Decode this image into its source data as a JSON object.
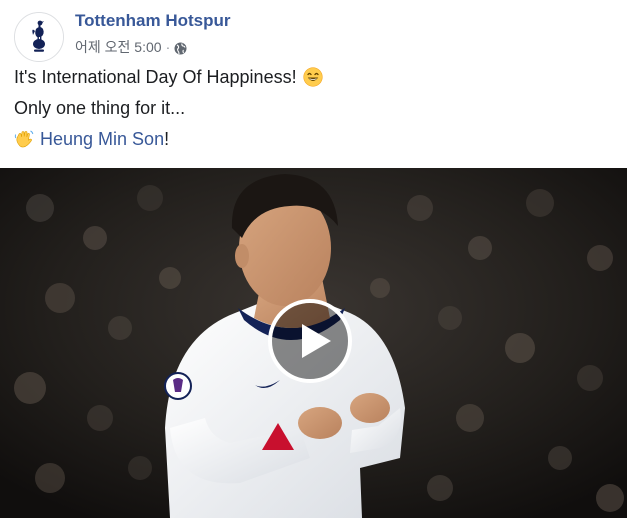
{
  "post": {
    "page_name": "Tottenham Hotspur",
    "time": "어제 오전 5:00",
    "separator": "·",
    "privacy_icon": "globe-icon",
    "lines": [
      "It's International Day Of Happiness!",
      "Only one thing for it...",
      "Heung Min Son!"
    ],
    "mention": "Heung Min Son",
    "mention_suffix": "!",
    "emojis": [
      "grinning-face-emoji",
      "waving-hand-emoji"
    ]
  },
  "media": {
    "type": "video",
    "play_icon": "play-icon"
  },
  "colors": {
    "link": "#385898",
    "text": "#1c1e21",
    "meta": "#616770",
    "spurs_navy": "#132257"
  }
}
